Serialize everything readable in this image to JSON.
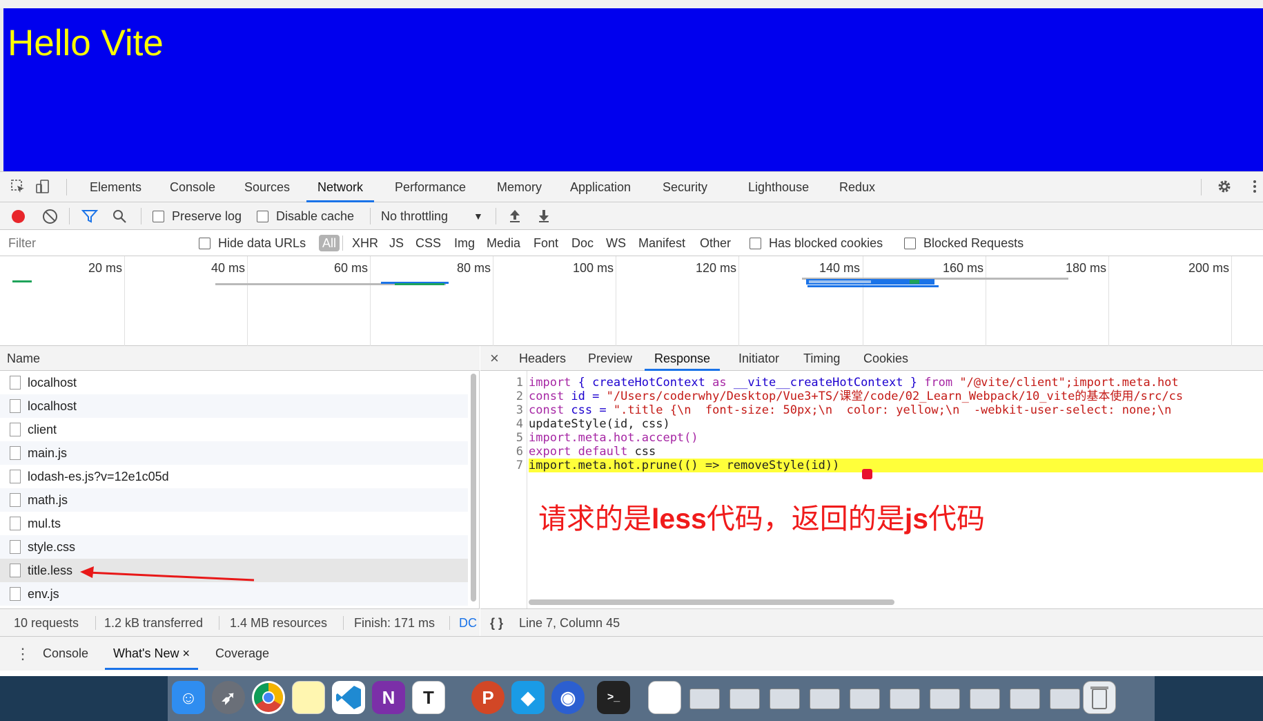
{
  "page": {
    "heading": "Hello Vite",
    "background": "#0000ee",
    "heading_color": "#ffff00"
  },
  "devtools": {
    "tabs": [
      "Elements",
      "Console",
      "Sources",
      "Network",
      "Performance",
      "Memory",
      "Application",
      "Security",
      "Lighthouse",
      "Redux"
    ],
    "active_tab": "Network",
    "icons": [
      "inspect-element-icon",
      "device-toolbar-icon",
      "gear-icon",
      "more-vertical-icon"
    ]
  },
  "network_toolbar": {
    "preserve_log": "Preserve log",
    "disable_cache": "Disable cache",
    "throttling": "No throttling",
    "record_color": "#e8262b"
  },
  "filter": {
    "placeholder": "Filter",
    "hide_data_urls": "Hide data URLs",
    "types": [
      "All",
      "XHR",
      "JS",
      "CSS",
      "Img",
      "Media",
      "Font",
      "Doc",
      "WS",
      "Manifest",
      "Other"
    ],
    "has_blocked_cookies": "Has blocked cookies",
    "blocked_requests": "Blocked Requests"
  },
  "overview": {
    "ticks": [
      "20 ms",
      "40 ms",
      "60 ms",
      "80 ms",
      "100 ms",
      "120 ms",
      "140 ms",
      "160 ms",
      "180 ms",
      "200 ms"
    ]
  },
  "requests": {
    "header": "Name",
    "items": [
      "localhost",
      "localhost",
      "client",
      "main.js",
      "lodash-es.js?v=12e1c05d",
      "math.js",
      "mul.ts",
      "style.css",
      "title.less",
      "env.js"
    ],
    "selected": "title.less",
    "summary": {
      "count": "10 requests",
      "transferred": "1.2 kB transferred",
      "resources": "1.4 MB resources",
      "finish": "Finish: 171 ms",
      "dc": "DC"
    }
  },
  "detail": {
    "tabs": [
      "Headers",
      "Preview",
      "Response",
      "Initiator",
      "Timing",
      "Cookies"
    ],
    "active_tab": "Response",
    "close": "×",
    "line_numbers": [
      "1",
      "2",
      "3",
      "4",
      "5",
      "6",
      "7"
    ],
    "code": {
      "l1_a": "import",
      "l1_b": " { createHotContext ",
      "l1_c": "as",
      "l1_d": " __vite__createHotContext } ",
      "l1_e": "from",
      "l1_f": " \"/@vite/client\";import.meta.hot",
      "l2_a": "const",
      "l2_b": " id = ",
      "l2_c": "\"/Users/coderwhy/Desktop/Vue3+TS/课堂/code/02_Learn_Webpack/10_vite的基本使用/src/cs",
      "l3_a": "const",
      "l3_b": " css = ",
      "l3_c": "\".title {\\n  font-size: 50px;\\n  color: yellow;\\n  -webkit-user-select: none;\\n",
      "l4": "updateStyle(id, css)",
      "l5": "import.meta.hot.accept()",
      "l6_a": "export",
      "l6_b": " ",
      "l6_c": "default",
      "l6_d": " css",
      "l7": "import.meta.hot.prune(() => removeStyle(id))"
    },
    "status": "Line 7, Column 45",
    "pretty_print": "{ }"
  },
  "annotation": {
    "part1": "请求的是",
    "bold1": "less",
    "part2": "代码，返回的是",
    "bold2": "js",
    "part3": "代码",
    "color": "#f01b1b"
  },
  "drawer": {
    "tabs": [
      "Console",
      "What's New",
      "Coverage"
    ],
    "active_tab": "What's New",
    "close": "×"
  },
  "dock": {
    "apps": [
      "finder-icon",
      "launchpad-icon",
      "chrome-icon",
      "notes-icon",
      "vscode-icon",
      "onenote-icon",
      "typora-icon",
      "powerpoint-icon",
      "paw-icon",
      "screen-recorder-icon",
      "terminal-icon",
      "document-icon",
      "trash-icon"
    ],
    "typora_letter": "T",
    "onenote_letter": "N"
  }
}
